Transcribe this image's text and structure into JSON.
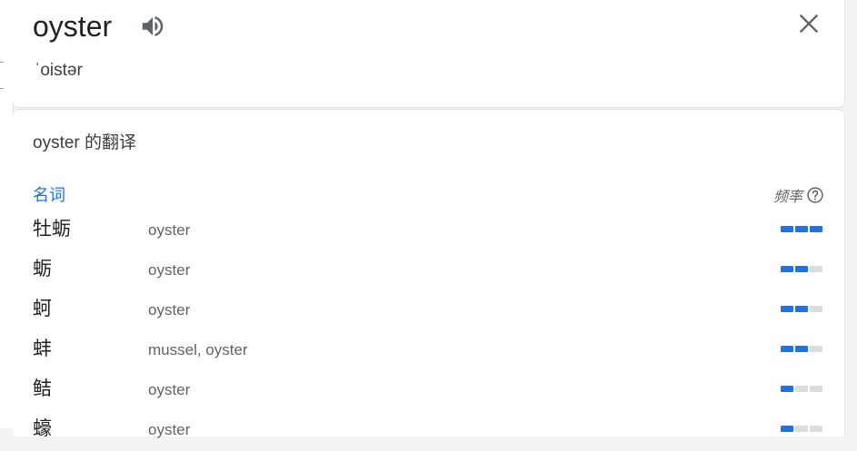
{
  "word": {
    "title": "oyster",
    "phonetic": "ˈoistər",
    "speaker_icon": "volume-icon",
    "close_icon": "close-icon"
  },
  "translations": {
    "heading": "oyster 的翻译",
    "part_of_speech": "名词",
    "frequency_label": "频率",
    "help_icon": "help-circle-icon",
    "colors": {
      "accent": "#1a73e8",
      "bar_off": "#dadce0"
    },
    "rows": [
      {
        "term": "牡蛎",
        "meaning": "oyster",
        "frequency": 3
      },
      {
        "term": "蛎",
        "meaning": "oyster",
        "frequency": 2
      },
      {
        "term": "蚵",
        "meaning": "oyster",
        "frequency": 2
      },
      {
        "term": "蚌",
        "meaning": "mussel, oyster",
        "frequency": 2
      },
      {
        "term": "鲒",
        "meaning": "oyster",
        "frequency": 1
      },
      {
        "term": "蠔",
        "meaning": "oyster",
        "frequency": 1
      }
    ]
  }
}
